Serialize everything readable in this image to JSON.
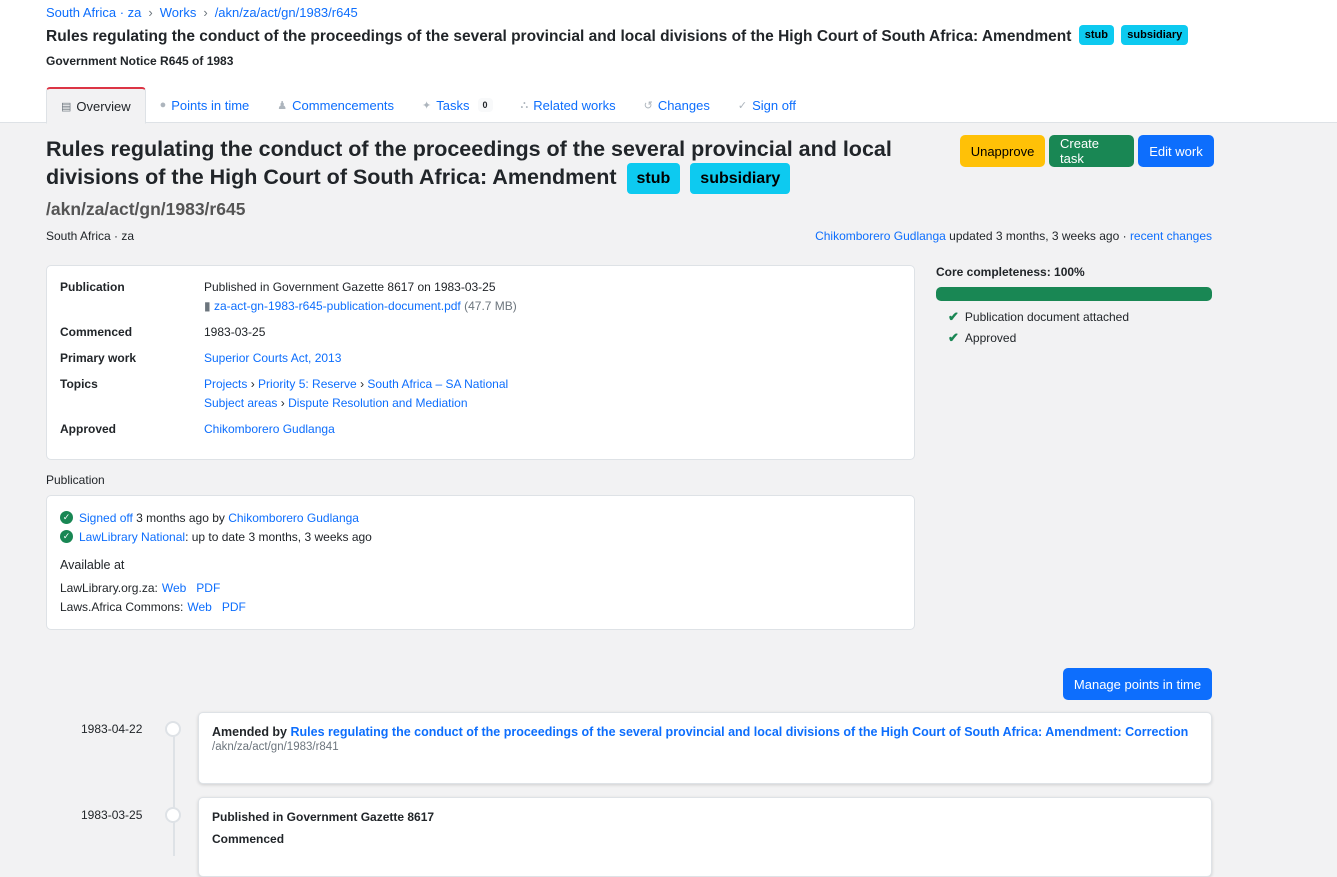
{
  "breadcrumb": {
    "place": "South Africa · za",
    "works": "Works",
    "frbr": "/akn/za/act/gn/1983/r645"
  },
  "header": {
    "title": "Rules regulating the conduct of the proceedings of the several provincial and local divisions of the High Court of South Africa: Amendment",
    "badges": [
      "stub",
      "subsidiary"
    ],
    "notice": "Government Notice R645 of 1983"
  },
  "tabs": [
    {
      "label": "Overview",
      "icon": "document-icon"
    },
    {
      "label": "Points in time",
      "icon": "clock-icon"
    },
    {
      "label": "Commencements",
      "icon": "person-icon"
    },
    {
      "label": "Tasks",
      "icon": "pin-icon",
      "count": "0"
    },
    {
      "label": "Related works",
      "icon": "hierarchy-icon"
    },
    {
      "label": "Changes",
      "icon": "history-icon"
    },
    {
      "label": "Sign off",
      "icon": "check-circle-icon"
    }
  ],
  "main": {
    "title": "Rules regulating the conduct of the proceedings of the several provincial and local divisions of the High Court of South Africa: Amendment",
    "badges": [
      "stub",
      "subsidiary"
    ],
    "frbr": "/akn/za/act/gn/1983/r645",
    "region": "South Africa · za"
  },
  "actions": {
    "unapprove": "Unapprove",
    "create_task": "Create task",
    "edit_work": "Edit work"
  },
  "updated": {
    "user": "Chikomborero Gudlanga",
    "text": " updated 3 months, 3 weeks ago · ",
    "link": "recent changes"
  },
  "details": {
    "publication_label": "Publication",
    "publication_text": "Published in Government Gazette 8617 on 1983-03-25",
    "publication_file": "za-act-gn-1983-r645-publication-document.pdf",
    "publication_size": "(47.7 MB)",
    "commenced_label": "Commenced",
    "commenced_value": "1983-03-25",
    "primary_label": "Primary work",
    "primary_value": "Superior Courts Act, 2013",
    "topics_label": "Topics",
    "topics_line1": [
      "Projects",
      "Priority 5: Reserve",
      "South Africa – SA National"
    ],
    "topics_line2": [
      "Subject areas",
      "Dispute Resolution and Mediation"
    ],
    "approved_label": "Approved",
    "approved_value": "Chikomborero Gudlanga"
  },
  "core": {
    "title": "Core completeness: 100%",
    "percent": 100,
    "checks": [
      "Publication document attached",
      "Approved"
    ]
  },
  "publication": {
    "label": "Publication",
    "signed_link": "Signed off",
    "signed_text": " 3 months ago by ",
    "signed_user": "Chikomborero Gudlanga",
    "lawlib_link": "LawLibrary National",
    "lawlib_text": ": up to date 3 months, 3 weeks ago",
    "available_heading": "Available at",
    "sites": [
      {
        "name": "LawLibrary.org.za:",
        "web": "Web",
        "pdf": "PDF"
      },
      {
        "name": "Laws.Africa Commons:",
        "web": "Web",
        "pdf": "PDF"
      }
    ]
  },
  "manage_button": "Manage points in time",
  "timeline": [
    {
      "date": "1983-04-22",
      "prefix": "Amended by ",
      "link": "Rules regulating the conduct of the proceedings of the several provincial and local divisions of the High Court of South Africa: Amendment: Correction",
      "sub": "/akn/za/act/gn/1983/r841"
    },
    {
      "date": "1983-03-25",
      "line1": "Published in Government Gazette 8617",
      "line2": "Commenced"
    }
  ]
}
